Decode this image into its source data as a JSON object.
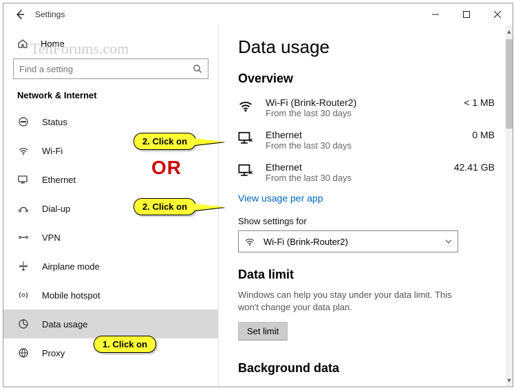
{
  "window": {
    "title": "Settings",
    "watermark": "TenForums.com"
  },
  "sidebar": {
    "home": "Home",
    "search_placeholder": "Find a setting",
    "section": "Network & Internet",
    "items": [
      {
        "id": "status",
        "label": "Status",
        "icon": "status-icon"
      },
      {
        "id": "wifi",
        "label": "Wi-Fi",
        "icon": "wifi-icon"
      },
      {
        "id": "ethernet",
        "label": "Ethernet",
        "icon": "ethernet-icon"
      },
      {
        "id": "dialup",
        "label": "Dial-up",
        "icon": "dialup-icon"
      },
      {
        "id": "vpn",
        "label": "VPN",
        "icon": "vpn-icon"
      },
      {
        "id": "airplane",
        "label": "Airplane mode",
        "icon": "airplane-icon"
      },
      {
        "id": "hotspot",
        "label": "Mobile hotspot",
        "icon": "hotspot-icon"
      },
      {
        "id": "datausage",
        "label": "Data usage",
        "icon": "datausage-icon",
        "selected": true
      },
      {
        "id": "proxy",
        "label": "Proxy",
        "icon": "proxy-icon"
      }
    ]
  },
  "content": {
    "title": "Data usage",
    "overview_header": "Overview",
    "overview": [
      {
        "name": "Wi-Fi (Brink-Router2)",
        "sub": "From the last 30 days",
        "value": "< 1 MB",
        "icon": "wifi"
      },
      {
        "name": "Ethernet",
        "sub": "From the last 30 days",
        "value": "0 MB",
        "icon": "eth"
      },
      {
        "name": "Ethernet",
        "sub": "From the last 30 days",
        "value": "42.41 GB",
        "icon": "eth"
      }
    ],
    "view_usage_link": "View usage per app",
    "show_settings_label": "Show settings for",
    "show_settings_value": "Wi-Fi (Brink-Router2)",
    "data_limit_header": "Data limit",
    "data_limit_desc": "Windows can help you stay under your data limit. This won't change your data plan.",
    "set_limit_button": "Set limit",
    "background_header": "Background data"
  },
  "annotations": {
    "c1": "1. Click on",
    "c2a": "2. Click on",
    "c2b": "2. Click on",
    "or": "OR"
  }
}
